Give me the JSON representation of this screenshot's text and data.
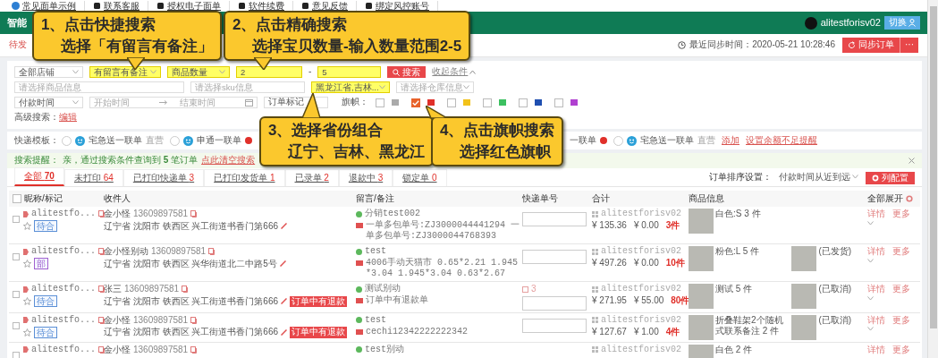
{
  "top_links": [
    "常见面单示例",
    "联系客服",
    "授权电子面单",
    "软件续费",
    "意见反馈",
    "绑定风控账号"
  ],
  "header": {
    "app_title": "智能",
    "user": "alitestforisv02",
    "switch_button": "切换"
  },
  "subheader": {
    "tab": "待发",
    "sync_label": "最近同步时间：2020-05-21 10:28:46",
    "sync_button": "同步订单",
    "more_button": "···"
  },
  "filters": {
    "rows": [
      {
        "items": [
          {
            "kind": "select",
            "value": "全部店铺",
            "highlighted": false
          },
          {
            "kind": "select",
            "value": "有留言有备注",
            "highlighted": true
          },
          {
            "kind": "select",
            "value": "商品数量",
            "highlighted": true
          },
          {
            "kind": "input",
            "value": "2",
            "highlighted": true
          },
          {
            "kind": "text",
            "text": "-"
          },
          {
            "kind": "input",
            "value": "5",
            "highlighted": true
          },
          {
            "kind": "button",
            "label": "搜索"
          },
          {
            "kind": "link",
            "label": "收起条件"
          }
        ]
      },
      {
        "items": [
          {
            "kind": "input",
            "placeholder": "请选择商品信息",
            "highlighted": false
          },
          {
            "kind": "input",
            "placeholder": "请选择sku信息",
            "highlighted": false
          },
          {
            "kind": "select",
            "value": "黑龙江省,吉林...",
            "highlighted": true
          },
          {
            "kind": "select",
            "placeholder": "请选择仓库信息",
            "highlighted": false
          }
        ]
      },
      {
        "items": [
          {
            "kind": "select",
            "value": "付款时间",
            "highlighted": false
          },
          {
            "kind": "daterange",
            "start_placeholder": "开始时间",
            "end_placeholder": "结束时间",
            "highlighted": false
          },
          {
            "kind": "input",
            "value": "订单标记",
            "highlighted": false
          },
          {
            "kind": "flags",
            "label": "旗帜：",
            "flags": [
              {
                "color": "#aaaaaa",
                "checked": false
              },
              {
                "color": "#e0302a",
                "checked": true
              },
              {
                "color": "#f2c21b",
                "checked": false
              },
              {
                "color": "#3cc060",
                "checked": false
              },
              {
                "color": "#1f4fb0",
                "checked": false
              },
              {
                "color": "#b040d0",
                "checked": false
              }
            ]
          }
        ]
      }
    ],
    "advanced": {
      "label": "高级搜索：",
      "link": "编辑"
    }
  },
  "templates": {
    "label": "快递模板：",
    "items": [
      {
        "name": "宅急送一联单",
        "tag": "直营",
        "warning": false,
        "selected": false
      },
      {
        "name": "申通一联单",
        "warning": true,
        "selected": false
      },
      {
        "name": "一联单",
        "warning": true
      },
      {
        "name": "宅急送一联单",
        "tag": "直营",
        "warning": false,
        "selected": false
      }
    ],
    "links": [
      "添加",
      "设置余额不足提醒"
    ]
  },
  "hint": {
    "label": "搜索提醒：",
    "message": "亲，通过搜索条件查询到 **5** 笔订单",
    "clear_link": "点此清空搜索"
  },
  "tabs": [
    {
      "label": "全部",
      "count": "70",
      "selected": true
    },
    {
      "label": "未打印",
      "count": "64",
      "selected": false
    },
    {
      "label": "已打印快递单",
      "count": "3",
      "selected": false
    },
    {
      "label": "已打印发货单",
      "count": "1",
      "selected": false
    },
    {
      "label": "已录单",
      "count": "2",
      "selected": false
    },
    {
      "label": "退款中",
      "count": "3",
      "selected": false
    },
    {
      "label": "锁定单",
      "count": "0",
      "selected": false
    }
  ],
  "sort": {
    "label": "订单排序设置：",
    "value": "付款时间从近到远"
  },
  "column_config_button": "列配置",
  "table": {
    "select_all_checked": false,
    "columns": [
      "昵称/标记",
      "收件人",
      "留言/备注",
      "快递单号",
      "合计",
      "商品信息",
      "全部展开"
    ],
    "rows": [
      {
        "checked": false,
        "nick": "alitestfo...",
        "starred": false,
        "tag": {
          "text": "待合",
          "color": "#5b8fd6"
        },
        "receiver": "金小怪",
        "phone": "13609897581",
        "address": "辽宁省 沈阳市 铁西区 兴工街道书香门第666",
        "message": "分销test002",
        "note": "一单多包单号:ZJ3000044441294 一单多包单号:ZJ3000044768393",
        "shop": "alitestforisv02",
        "amount": "¥ 135.36",
        "discount": "¥ 0.00",
        "quantity": "3件",
        "goods": [
          "白色:S 3 件"
        ],
        "actions": [
          "详情",
          "更多"
        ]
      },
      {
        "checked": false,
        "nick": "alitestfo...",
        "starred": false,
        "tag": {
          "text": "部",
          "color": "#a060d0"
        },
        "receiver": "金小怪别动",
        "phone": "13609897581",
        "address": "辽宁省 沈阳市 铁西区 兴华街道北二中路5号",
        "message": "test",
        "note": "4006手动天猫市 0.65*2.21 1.945*3.04 1.945*3.04 0.63*2.67",
        "shop": "alitestforisv02",
        "amount": "¥ 497.26",
        "discount": "¥ 0.00",
        "quantity": "10件",
        "goods": [
          "粉色:L 5 件",
          "(已发货)"
        ],
        "actions": [
          "详情",
          "更多"
        ]
      },
      {
        "checked": false,
        "nick": "alitestfo...",
        "starred": false,
        "tag": {
          "text": "待合",
          "color": "#5b8fd6"
        },
        "receiver": "张三",
        "phone": "13609897581",
        "address": "辽宁省 沈阳市 铁西区 兴工街道书香门第666",
        "badge": "订单中有退款",
        "message": "测试别动",
        "note": "订单中有退款单",
        "express_count": "3",
        "shop": "alitestforisv02",
        "amount": "¥ 271.95",
        "discount": "¥ 55.00",
        "quantity": "80件",
        "goods": [
          "测试 5 件",
          "(已取消)"
        ],
        "actions": [
          "详情",
          "更多"
        ]
      },
      {
        "checked": false,
        "nick": "alitestfo...",
        "starred": false,
        "tag": {
          "text": "待合",
          "color": "#5b8fd6"
        },
        "receiver": "金小怪",
        "phone": "13609897581",
        "address": "辽宁省 沈阳市 铁西区 兴工街道书香门第666",
        "badge": "订单中有退款",
        "message": "test",
        "note": "cechi12342222222342",
        "shop": "alitestforisv02",
        "amount": "¥ 127.67",
        "discount": "¥ 1.00",
        "quantity": "4件",
        "goods": [
          "折叠鞋架2个随机式联系备注 2 件",
          "(已取消)"
        ],
        "actions": [
          "详情",
          "更多"
        ]
      },
      {
        "checked": false,
        "nick": "alitestfo...",
        "receiver": "金小怪",
        "phone": "13609897581",
        "message": "test别动",
        "shop": "alitestforisv02",
        "goods": [
          "白色 2 件"
        ],
        "actions": [
          "详情",
          "更多"
        ]
      }
    ]
  },
  "callouts": [
    {
      "lines": [
        "1、点击快捷搜索",
        "选择「有留言有备注」"
      ]
    },
    {
      "lines": [
        "2、点击精确搜索",
        "选择宝贝数量-输入数量范围2-5"
      ]
    },
    {
      "lines": [
        "3、选择省份组合",
        "辽宁、吉林、黑龙江"
      ]
    },
    {
      "lines": [
        "4、点击旗帜搜索",
        "选择红色旗帜"
      ]
    }
  ]
}
